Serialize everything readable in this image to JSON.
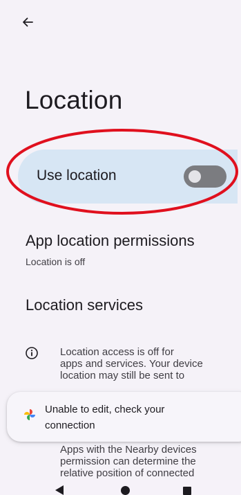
{
  "header": {
    "back_icon": "arrow-left-icon",
    "title": "Location"
  },
  "use_location": {
    "label": "Use location",
    "toggle_on": false,
    "toggle_color": "#7b7c80",
    "row_background": "#d7e6f4"
  },
  "annotation": {
    "shape": "oval",
    "color": "#e0101e"
  },
  "app_permissions": {
    "title": "App location permissions",
    "subtitle": "Location is off"
  },
  "services": {
    "title": "Location services"
  },
  "info": {
    "icon": "info-circle-icon",
    "line1": "Location access is off for",
    "line2": "apps and services. Your device",
    "line3": "location may still be sent to",
    "nearby_line1": "Apps with the Nearby devices",
    "nearby_line2": "permission can determine the",
    "nearby_line3": "relative position of connected"
  },
  "toast": {
    "icon": "google-pinwheel-icon",
    "line1": "Unable to edit, check your",
    "line2": "connection"
  },
  "navbar": {
    "back_icon": "nav-back-icon",
    "home_icon": "nav-home-icon",
    "recents_icon": "nav-recents-icon"
  }
}
